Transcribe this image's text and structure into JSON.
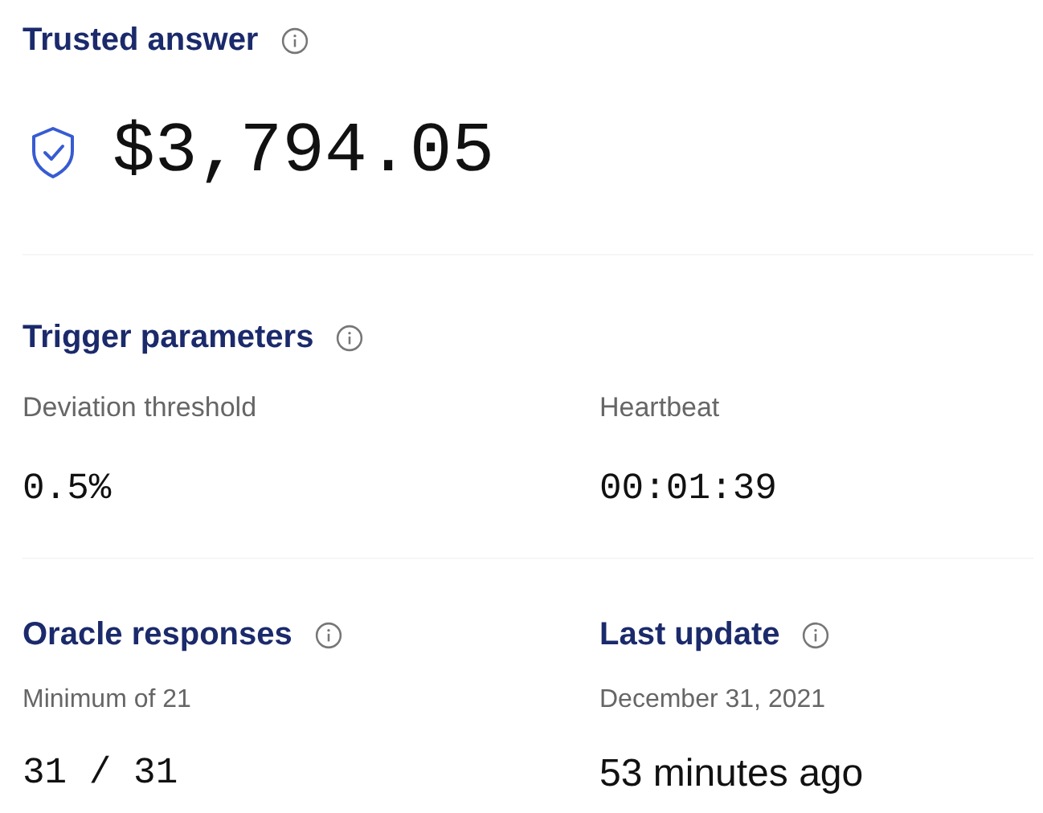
{
  "trusted_answer": {
    "title": "Trusted answer",
    "value": "$3,794.05"
  },
  "trigger_parameters": {
    "title": "Trigger parameters",
    "items": [
      {
        "label": "Deviation threshold",
        "value": "0.5%"
      },
      {
        "label": "Heartbeat",
        "value": "00:01:39"
      }
    ]
  },
  "stats": [
    {
      "title": "Oracle responses",
      "subtitle": "Minimum of 21",
      "value": "31 / 31",
      "kind": "mono"
    },
    {
      "title": "Last update",
      "subtitle": "December 31, 2021",
      "value": "53 minutes ago",
      "kind": "sans"
    }
  ]
}
